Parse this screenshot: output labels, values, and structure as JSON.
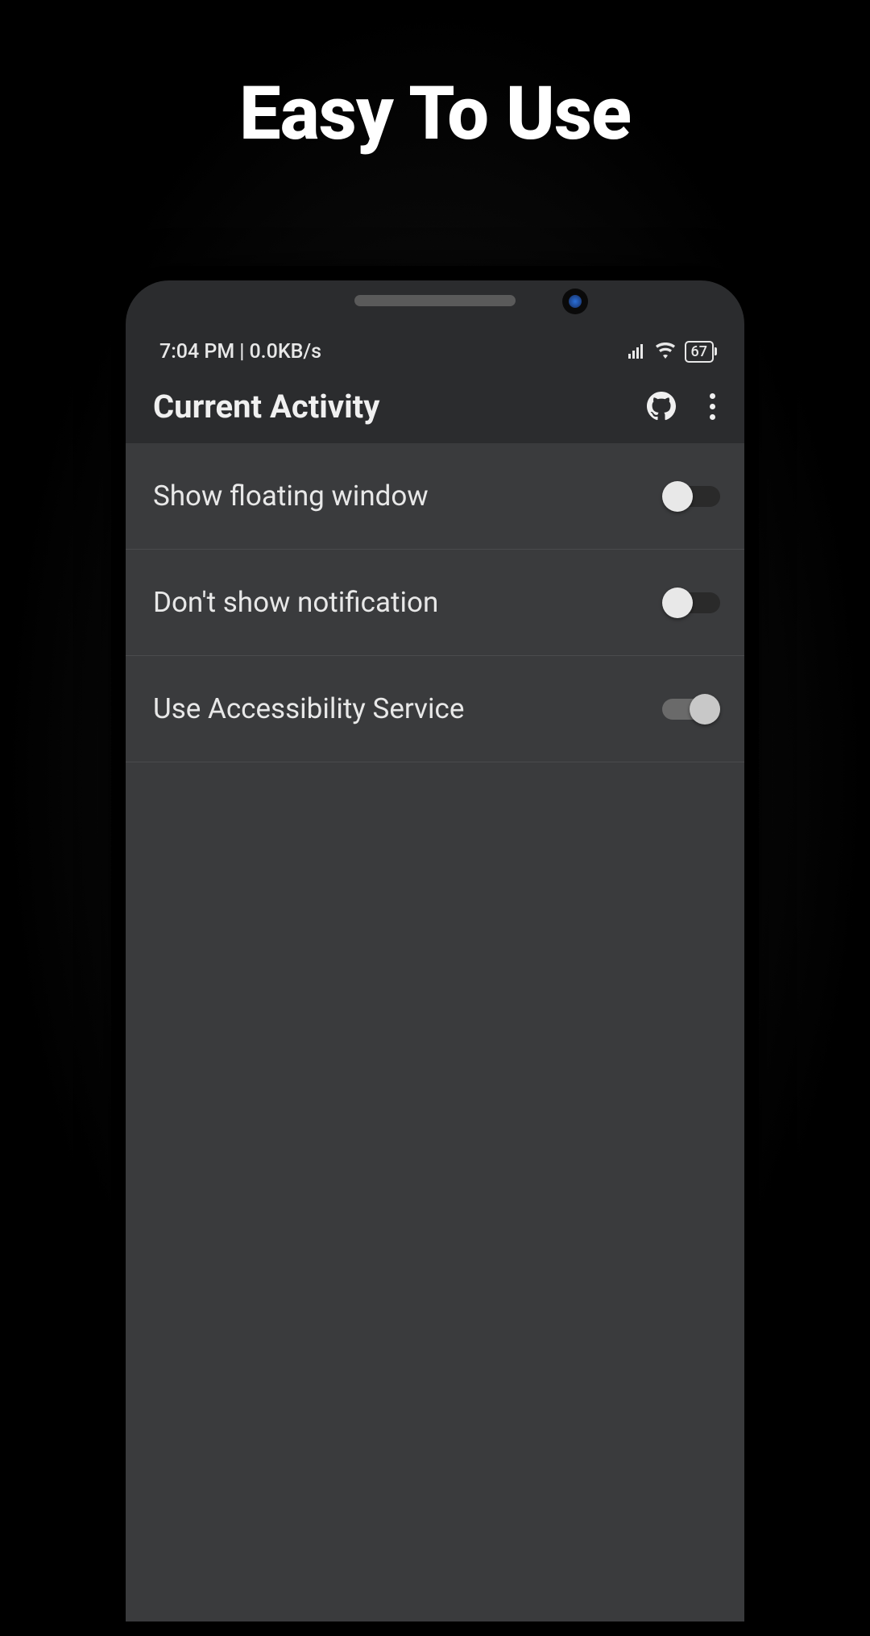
{
  "headline": "Easy To Use",
  "status_bar": {
    "time": "7:04 PM",
    "separator": "|",
    "network_speed": "0.0KB/s",
    "battery": "67"
  },
  "app_bar": {
    "title": "Current Activity"
  },
  "settings": [
    {
      "label": "Show floating window",
      "enabled": false
    },
    {
      "label": "Don't show notification",
      "enabled": false
    },
    {
      "label": "Use Accessibility Service",
      "enabled": true
    }
  ]
}
